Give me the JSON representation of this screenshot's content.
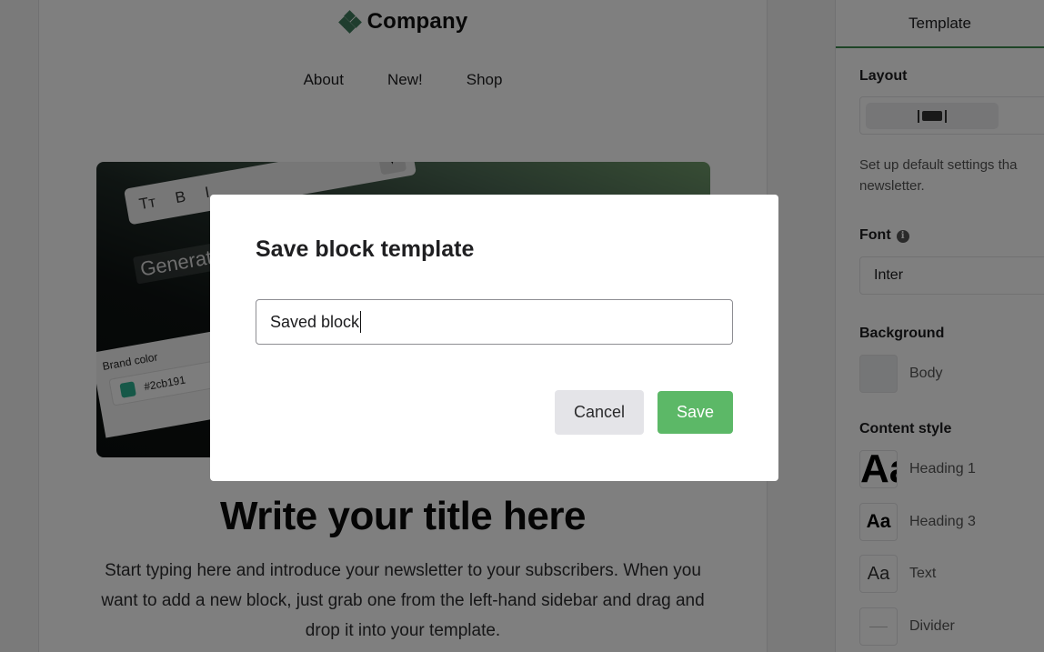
{
  "canvas": {
    "brand": {
      "name": "Company",
      "logo_icon": "diamond-cluster-icon",
      "logo_color": "#3f7a5c"
    },
    "nav": [
      {
        "label": "About"
      },
      {
        "label": "New!"
      },
      {
        "label": "Shop"
      }
    ],
    "hero": {
      "toolbar_items": [
        "Tт",
        "B",
        "I"
      ],
      "generate_label": "Generate",
      "brand_color_label": "Brand color",
      "brand_color_value": "#2cb191",
      "sparkle_icon": "✦"
    },
    "title": "Write your title here",
    "body": "Start typing here and introduce your newsletter to your subscribers. When you want to add a new block, just grab one from the left-hand sidebar and drag and drop it into your template."
  },
  "right_panel": {
    "tab": "Template",
    "layout_label": "Layout",
    "description_line1": "Set up default settings tha",
    "description_line2": "newsletter.",
    "font_label": "Font",
    "font_info_icon": "i",
    "font_value": "Inter",
    "background_label": "Background",
    "background_items": [
      {
        "label": "Body",
        "color": "#ebecee"
      }
    ],
    "content_style_label": "Content style",
    "content_styles": [
      {
        "label": "Heading 1",
        "preview": "Aa"
      },
      {
        "label": "Heading 3",
        "preview": "Aa"
      },
      {
        "label": "Text",
        "preview": "Aa"
      },
      {
        "label": "Divider",
        "preview": ""
      }
    ],
    "accent_color": "#3c8a4e"
  },
  "modal": {
    "title": "Save block template",
    "input_value": "Saved block",
    "cancel_label": "Cancel",
    "save_label": "Save",
    "save_color": "#5cb867"
  }
}
